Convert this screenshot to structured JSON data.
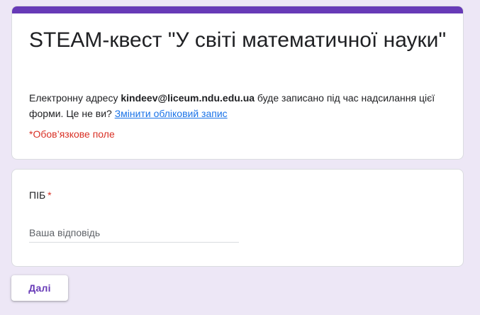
{
  "theme": {
    "accent_color": "#673ab7",
    "background_color": "#ede7f6",
    "required_color": "#d93025",
    "link_color": "#1a73e8"
  },
  "form": {
    "title": "STEAM-квест \"У світі математичної науки\"",
    "email_notice": {
      "prefix": "Електронну адресу ",
      "email": "kindeev@liceum.ndu.edu.ua",
      "suffix": " буде записано під час надсилання цієї форми. Це не ви? ",
      "switch_link": "Змінити обліковий запис"
    },
    "required_note": "*Обов’язкове поле"
  },
  "question": {
    "title": "ПІБ",
    "required_marker": "*",
    "placeholder": "Ваша відповідь",
    "value": ""
  },
  "actions": {
    "next_label": "Далі"
  }
}
